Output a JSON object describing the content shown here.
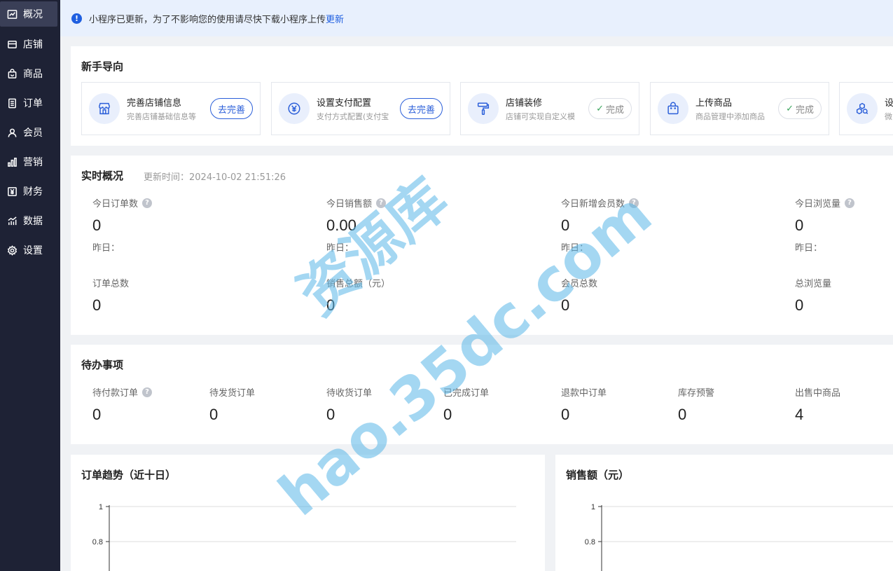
{
  "sidebar": {
    "items": [
      {
        "label": "概况",
        "icon": "chart-line-icon",
        "active": true
      },
      {
        "label": "店铺",
        "icon": "store-icon"
      },
      {
        "label": "商品",
        "icon": "bag-icon"
      },
      {
        "label": "订单",
        "icon": "document-icon"
      },
      {
        "label": "会员",
        "icon": "user-icon"
      },
      {
        "label": "营销",
        "icon": "bar-chart-icon"
      },
      {
        "label": "财务",
        "icon": "yen-icon"
      },
      {
        "label": "数据",
        "icon": "data-chart-icon"
      },
      {
        "label": "设置",
        "icon": "gear-icon"
      }
    ]
  },
  "notice": {
    "icon": "info-icon",
    "text": "小程序已更新，为了不影响您的使用请尽快下载小程序上传",
    "link": "更新"
  },
  "guide": {
    "title": "新手导向",
    "items": [
      {
        "name": "完善店铺信息",
        "desc": "完善店铺基础信息等",
        "button": "去完善",
        "status": "todo",
        "icon": "store-icon"
      },
      {
        "name": "设置支付配置",
        "desc": "支付方式配置(支付宝",
        "button": "去完善",
        "status": "todo",
        "icon": "yen-icon"
      },
      {
        "name": "店铺装修",
        "desc": "店铺可实现自定义模",
        "button": "完成",
        "status": "done",
        "icon": "paint-roller-icon"
      },
      {
        "name": "上传商品",
        "desc": "商品管理中添加商品",
        "button": "完成",
        "status": "done",
        "icon": "bag-icon"
      },
      {
        "name": "设",
        "desc": "微",
        "button": "",
        "status": "hidden",
        "icon": "cubes-icon"
      }
    ]
  },
  "realtime": {
    "title": "实时概况",
    "update_time": "更新时间：2024-10-02 21:51:26",
    "today": [
      {
        "label": "今日订单数",
        "value": "0",
        "sub": "昨日：",
        "help": true
      },
      {
        "label": "今日销售额",
        "value": "0.00",
        "sub": "昨日：",
        "help": true
      },
      {
        "label": "今日新增会员数",
        "value": "0",
        "sub": "昨日：",
        "help": true
      },
      {
        "label": "今日浏览量",
        "value": "0",
        "sub": "昨日：",
        "help": true
      }
    ],
    "totals": [
      {
        "label": "订单总数",
        "value": "0"
      },
      {
        "label": "销售总额（元）",
        "value": "0"
      },
      {
        "label": "会员总数",
        "value": "0"
      },
      {
        "label": "总浏览量",
        "value": "0"
      }
    ]
  },
  "todo": {
    "title": "待办事项",
    "items": [
      {
        "label": "待付款订单",
        "value": "0",
        "help": true
      },
      {
        "label": "待发货订单",
        "value": "0"
      },
      {
        "label": "待收货订单",
        "value": "0"
      },
      {
        "label": "已完成订单",
        "value": "0"
      },
      {
        "label": "退款中订单",
        "value": "0"
      },
      {
        "label": "库存预警",
        "value": "0"
      },
      {
        "label": "出售中商品",
        "value": "4"
      }
    ]
  },
  "charts": {
    "order_trend_title": "订单趋势（近十日）",
    "sales_title": "销售额（元）"
  },
  "chart_data": [
    {
      "type": "line",
      "title": "订单趋势（近十日）",
      "y_ticks": [
        "1",
        "0.8"
      ],
      "ylim": [
        0,
        1
      ],
      "grid": true
    },
    {
      "type": "line",
      "title": "销售额（元）",
      "y_ticks": [
        "1",
        "0.8"
      ],
      "ylim": [
        0,
        1
      ],
      "grid": true
    }
  ],
  "watermark": {
    "line1": "资源库",
    "line2": "hao.35dc.com",
    "color": "#5ab7e8"
  },
  "colors": {
    "accent": "#1f5fe0",
    "sidebar_bg": "#1e2235",
    "done_check": "#3aa55d"
  }
}
